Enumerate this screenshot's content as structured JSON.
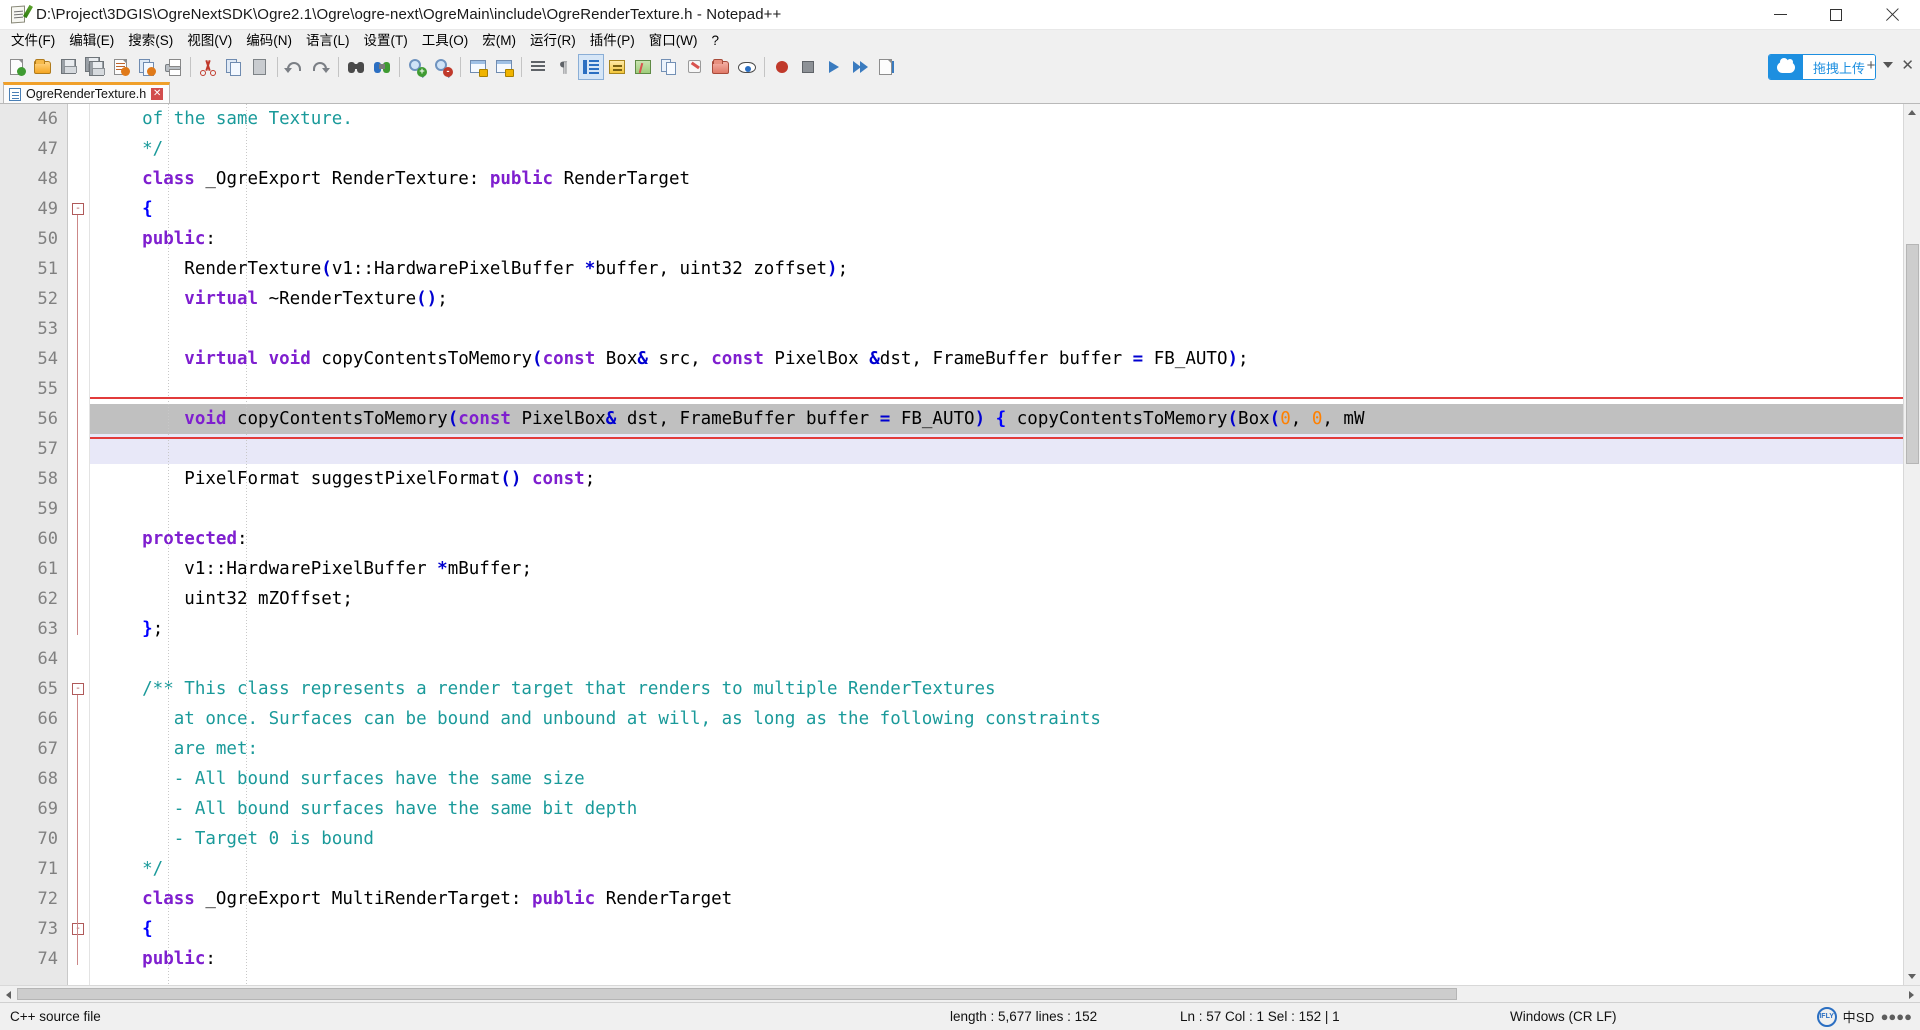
{
  "window": {
    "title": "D:\\Project\\3DGIS\\OgreNextSDK\\Ogre2.1\\Ogre\\ogre-next\\OgreMain\\include\\OgreRenderTexture.h - Notepad++",
    "app_icon": "notepad-plus-plus-icon",
    "minimize_label": "—",
    "maximize_label": "□",
    "close_label": "✕"
  },
  "menu": {
    "items": [
      {
        "label": "文件(F)",
        "name": "menu-file"
      },
      {
        "label": "编辑(E)",
        "name": "menu-edit"
      },
      {
        "label": "搜索(S)",
        "name": "menu-search"
      },
      {
        "label": "视图(V)",
        "name": "menu-view"
      },
      {
        "label": "编码(N)",
        "name": "menu-encoding"
      },
      {
        "label": "语言(L)",
        "name": "menu-language"
      },
      {
        "label": "设置(T)",
        "name": "menu-settings"
      },
      {
        "label": "工具(O)",
        "name": "menu-tools"
      },
      {
        "label": "宏(M)",
        "name": "menu-macro"
      },
      {
        "label": "运行(R)",
        "name": "menu-run"
      },
      {
        "label": "插件(P)",
        "name": "menu-plugins"
      },
      {
        "label": "窗口(W)",
        "name": "menu-window"
      },
      {
        "label": "?",
        "name": "menu-help"
      }
    ]
  },
  "toolbar": {
    "upload_label": "拖拽上传",
    "upload_icon": "cloud-upload-icon",
    "right_plus": "+",
    "right_x": "✕"
  },
  "tabs": [
    {
      "label": "OgreRenderTexture.h",
      "close": "✕",
      "active": true
    }
  ],
  "editor": {
    "first_line": 46,
    "lines": [
      {
        "n": 46,
        "tokens": [
          {
            "t": "    of the same Texture.",
            "c": "cmt"
          }
        ]
      },
      {
        "n": 47,
        "tokens": [
          {
            "t": "    */",
            "c": "cmt"
          }
        ]
      },
      {
        "n": 48,
        "tokens": [
          {
            "t": "    ",
            "c": ""
          },
          {
            "t": "class",
            "c": "kw"
          },
          {
            "t": " _OgreExport RenderTexture: ",
            "c": ""
          },
          {
            "t": "public",
            "c": "kw"
          },
          {
            "t": " RenderTarget",
            "c": ""
          }
        ]
      },
      {
        "n": 49,
        "tokens": [
          {
            "t": "    ",
            "c": ""
          },
          {
            "t": "{",
            "c": "brace"
          }
        ]
      },
      {
        "n": 50,
        "tokens": [
          {
            "t": "    ",
            "c": ""
          },
          {
            "t": "public",
            "c": "kw"
          },
          {
            "t": ":",
            "c": ""
          }
        ]
      },
      {
        "n": 51,
        "tokens": [
          {
            "t": "        RenderTexture",
            "c": ""
          },
          {
            "t": "(",
            "c": "op"
          },
          {
            "t": "v1::HardwarePixelBuffer ",
            "c": ""
          },
          {
            "t": "*",
            "c": "op"
          },
          {
            "t": "buffer, uint32 zoffset",
            "c": ""
          },
          {
            "t": ")",
            "c": "op"
          },
          {
            "t": ";",
            "c": ""
          }
        ]
      },
      {
        "n": 52,
        "tokens": [
          {
            "t": "        ",
            "c": ""
          },
          {
            "t": "virtual",
            "c": "kw"
          },
          {
            "t": " ~RenderTexture",
            "c": ""
          },
          {
            "t": "()",
            "c": "op"
          },
          {
            "t": ";",
            "c": ""
          }
        ]
      },
      {
        "n": 53,
        "tokens": [
          {
            "t": "",
            "c": ""
          }
        ]
      },
      {
        "n": 54,
        "tokens": [
          {
            "t": "        ",
            "c": ""
          },
          {
            "t": "virtual",
            "c": "kw"
          },
          {
            "t": " ",
            "c": ""
          },
          {
            "t": "void",
            "c": "kw"
          },
          {
            "t": " copyContentsToMemory",
            "c": ""
          },
          {
            "t": "(",
            "c": "op"
          },
          {
            "t": "const",
            "c": "kw"
          },
          {
            "t": " Box",
            "c": ""
          },
          {
            "t": "&",
            "c": "op"
          },
          {
            "t": " src, ",
            "c": ""
          },
          {
            "t": "const",
            "c": "kw"
          },
          {
            "t": " PixelBox ",
            "c": ""
          },
          {
            "t": "&",
            "c": "op"
          },
          {
            "t": "dst, FrameBuffer buffer ",
            "c": ""
          },
          {
            "t": "=",
            "c": "op"
          },
          {
            "t": " FB_AUTO",
            "c": ""
          },
          {
            "t": ")",
            "c": "op"
          },
          {
            "t": ";",
            "c": ""
          }
        ]
      },
      {
        "n": 55,
        "tokens": [
          {
            "t": "",
            "c": ""
          }
        ]
      },
      {
        "n": 56,
        "selected": true,
        "tokens": [
          {
            "t": "        ",
            "c": ""
          },
          {
            "t": "void",
            "c": "kw"
          },
          {
            "t": " copyContentsToMemory",
            "c": ""
          },
          {
            "t": "(",
            "c": "op"
          },
          {
            "t": "const",
            "c": "kw"
          },
          {
            "t": " PixelBox",
            "c": ""
          },
          {
            "t": "&",
            "c": "op"
          },
          {
            "t": " dst, FrameBuffer buffer ",
            "c": ""
          },
          {
            "t": "=",
            "c": "op"
          },
          {
            "t": " FB_AUTO",
            "c": "op2"
          },
          {
            "t": ")",
            "c": "op"
          },
          {
            "t": " ",
            "c": ""
          },
          {
            "t": "{",
            "c": "brace"
          },
          {
            "t": " copyContentsToMemory",
            "c": ""
          },
          {
            "t": "(",
            "c": "op"
          },
          {
            "t": "Box",
            "c": ""
          },
          {
            "t": "(",
            "c": "op"
          },
          {
            "t": "0",
            "c": "num"
          },
          {
            "t": ", ",
            "c": ""
          },
          {
            "t": "0",
            "c": "num"
          },
          {
            "t": ", mW",
            "c": ""
          }
        ]
      },
      {
        "n": 57,
        "caret": true,
        "tokens": [
          {
            "t": "",
            "c": ""
          }
        ]
      },
      {
        "n": 58,
        "tokens": [
          {
            "t": "        PixelFormat suggestPixelFormat",
            "c": ""
          },
          {
            "t": "()",
            "c": "op"
          },
          {
            "t": " ",
            "c": ""
          },
          {
            "t": "const",
            "c": "kw"
          },
          {
            "t": ";",
            "c": ""
          }
        ]
      },
      {
        "n": 59,
        "tokens": [
          {
            "t": "",
            "c": ""
          }
        ]
      },
      {
        "n": 60,
        "tokens": [
          {
            "t": "    ",
            "c": ""
          },
          {
            "t": "protected",
            "c": "kw"
          },
          {
            "t": ":",
            "c": ""
          }
        ]
      },
      {
        "n": 61,
        "tokens": [
          {
            "t": "        v1::HardwarePixelBuffer ",
            "c": ""
          },
          {
            "t": "*",
            "c": "op"
          },
          {
            "t": "mBuffer;",
            "c": ""
          }
        ]
      },
      {
        "n": 62,
        "tokens": [
          {
            "t": "        uint32 mZOffset;",
            "c": ""
          }
        ]
      },
      {
        "n": 63,
        "tokens": [
          {
            "t": "    ",
            "c": ""
          },
          {
            "t": "}",
            "c": "brace"
          },
          {
            "t": ";",
            "c": ""
          }
        ]
      },
      {
        "n": 64,
        "tokens": [
          {
            "t": "",
            "c": ""
          }
        ]
      },
      {
        "n": 65,
        "tokens": [
          {
            "t": "    /** This class represents a render target that renders to multiple RenderTextures",
            "c": "cmt"
          }
        ]
      },
      {
        "n": 66,
        "tokens": [
          {
            "t": "       at once. Surfaces can be bound and unbound at will, as long as the following constraints",
            "c": "cmt"
          }
        ]
      },
      {
        "n": 67,
        "tokens": [
          {
            "t": "       are met:",
            "c": "cmt"
          }
        ]
      },
      {
        "n": 68,
        "tokens": [
          {
            "t": "       - All bound surfaces have the same size",
            "c": "cmt"
          }
        ]
      },
      {
        "n": 69,
        "tokens": [
          {
            "t": "       - All bound surfaces have the same bit depth",
            "c": "cmt"
          }
        ]
      },
      {
        "n": 70,
        "tokens": [
          {
            "t": "       - Target 0 is bound",
            "c": "cmt"
          }
        ]
      },
      {
        "n": 71,
        "tokens": [
          {
            "t": "    */",
            "c": "cmt"
          }
        ]
      },
      {
        "n": 72,
        "tokens": [
          {
            "t": "    ",
            "c": ""
          },
          {
            "t": "class",
            "c": "kw"
          },
          {
            "t": " _OgreExport MultiRenderTarget: ",
            "c": ""
          },
          {
            "t": "public",
            "c": "kw"
          },
          {
            "t": " RenderTarget",
            "c": ""
          }
        ]
      },
      {
        "n": 73,
        "tokens": [
          {
            "t": "    ",
            "c": ""
          },
          {
            "t": "{",
            "c": "brace"
          }
        ]
      },
      {
        "n": 74,
        "tokens": [
          {
            "t": "    ",
            "c": ""
          },
          {
            "t": "public",
            "c": "kw"
          },
          {
            "t": ":",
            "c": ""
          }
        ]
      }
    ],
    "highlight_color": "#e23b3b",
    "selection_color": "#c0c0c0"
  },
  "statusbar": {
    "doc_type": "C++ source file",
    "length_lines": "length : 5,677   lines : 152",
    "position": "Ln : 57   Col : 1   Sel : 152 | 1",
    "eol": "Windows (CR LF)",
    "tray_ifly": "IFLY",
    "tray_ime": "中SD"
  }
}
